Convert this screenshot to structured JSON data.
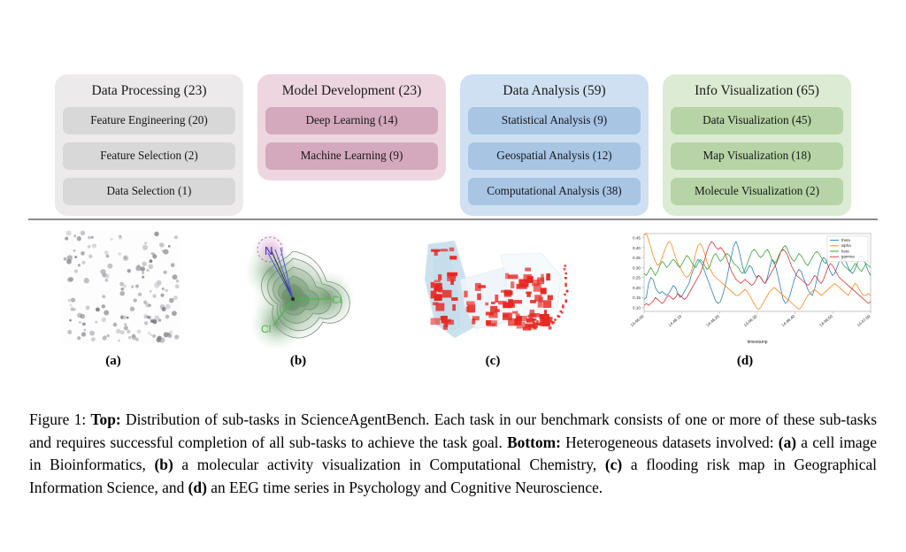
{
  "figure": {
    "label": "Figure 1:",
    "caption_segments": [
      {
        "text": "Figure 1: ",
        "bold": false
      },
      {
        "text": "Top:",
        "bold": true
      },
      {
        "text": " Distribution of sub-tasks in ScienceAgentBench. Each task in our benchmark consists of one or more of these sub-tasks and requires successful completion of all sub-tasks to achieve the task goal. ",
        "bold": false
      },
      {
        "text": "Bottom:",
        "bold": true
      },
      {
        "text": " Heterogeneous datasets involved: ",
        "bold": false
      },
      {
        "text": "(a)",
        "bold": true
      },
      {
        "text": " a cell image in Bioinformatics, ",
        "bold": false
      },
      {
        "text": "(b)",
        "bold": true
      },
      {
        "text": " a molecular activity visualization in Computational Chemistry, ",
        "bold": false
      },
      {
        "text": "(c)",
        "bold": true
      },
      {
        "text": " a flooding risk map in Geographical Information Science, and ",
        "bold": false
      },
      {
        "text": "(d)",
        "bold": true
      },
      {
        "text": " an EEG time series in Psychology and Cognitive Neuroscience.",
        "bold": false
      }
    ]
  },
  "taxonomy": {
    "categories": [
      {
        "title": "Data Processing (23)",
        "name": "data-processing",
        "palette": "pal-gray",
        "card_color": "#eceaea",
        "chip_color": "#d9d8d8",
        "subtasks": [
          {
            "label": "Feature Engineering (20)",
            "count": 20
          },
          {
            "label": "Feature Selection (2)",
            "count": 2
          },
          {
            "label": "Data Selection (1)",
            "count": 1
          }
        ]
      },
      {
        "title": "Model Development (23)",
        "name": "model-development",
        "palette": "pal-pink",
        "card_color": "#eed6e0",
        "chip_color": "#d4a9bd",
        "subtasks": [
          {
            "label": "Deep Learning (14)",
            "count": 14
          },
          {
            "label": "Machine Learning (9)",
            "count": 9
          }
        ]
      },
      {
        "title": "Data Analysis (59)",
        "name": "data-analysis",
        "palette": "pal-blue",
        "card_color": "#cfe0f2",
        "chip_color": "#a8c5e4",
        "subtasks": [
          {
            "label": "Statistical Analysis (9)",
            "count": 9
          },
          {
            "label": "Geospatial Analysis (12)",
            "count": 12
          },
          {
            "label": "Computational Analysis (38)",
            "count": 38
          }
        ]
      },
      {
        "title": "Info Visualization (65)",
        "name": "info-visualization",
        "palette": "pal-green",
        "card_color": "#dcebd3",
        "chip_color": "#b6d4a5",
        "subtasks": [
          {
            "label": "Data Visualization (45)",
            "count": 45
          },
          {
            "label": "Map Visualization (18)",
            "count": 18
          },
          {
            "label": "Molecule Visualization (2)",
            "count": 2
          }
        ]
      }
    ]
  },
  "panels": [
    {
      "key": "a",
      "caption": "(a)",
      "kind": "cell-image",
      "description": "cell image in Bioinformatics"
    },
    {
      "key": "b",
      "caption": "(b)",
      "kind": "molecule",
      "description": "molecular activity visualization in Computational Chemistry",
      "atom_labels": [
        {
          "text": "N",
          "color": "#3333cc"
        },
        {
          "text": "Cl",
          "color": "#44bb44"
        },
        {
          "text": "Cl",
          "color": "#44bb44"
        }
      ]
    },
    {
      "key": "c",
      "caption": "(c)",
      "kind": "map",
      "description": "flooding risk map in Geographical Information Science",
      "colors": {
        "water": "#c3dceb",
        "buildings": "#e8251f"
      }
    },
    {
      "key": "d",
      "caption": "(d)",
      "kind": "line-chart",
      "description": "EEG time series in Psychology and Cognitive Neuroscience"
    }
  ],
  "chart_data": {
    "type": "line",
    "title": "",
    "xlabel": "timestamp",
    "ylabel": "",
    "grid": false,
    "legend_position": "upper right",
    "ylim": [
      0.08,
      0.47
    ],
    "yticks": [
      0.1,
      0.15,
      0.2,
      0.25,
      0.3,
      0.35,
      0.4,
      0.45
    ],
    "ytick_labels": [
      "0.10",
      "0.15",
      "0.20",
      "0.25",
      "0.30",
      "0.35",
      "0.40",
      "0.45"
    ],
    "xticks": [
      0,
      10,
      20,
      30,
      40,
      50,
      60
    ],
    "xtick_labels": [
      "14:46:00",
      "14:46:10",
      "14:46:20",
      "14:46:30",
      "14:46:40",
      "14:46:50",
      "14:47:00"
    ],
    "series": [
      {
        "name": "theta",
        "color": "#1f77b4",
        "values": [
          0.14,
          0.15,
          0.22,
          0.25,
          0.24,
          0.2,
          0.18,
          0.17,
          0.18,
          0.17,
          0.16,
          0.17,
          0.19,
          0.21,
          0.2,
          0.17,
          0.15,
          0.16,
          0.18,
          0.2,
          0.22,
          0.26,
          0.29,
          0.32,
          0.34,
          0.33,
          0.31,
          0.28,
          0.25,
          0.22,
          0.19,
          0.16,
          0.13,
          0.12,
          0.13,
          0.16,
          0.2,
          0.25,
          0.31,
          0.36,
          0.41,
          0.43,
          0.4,
          0.35,
          0.3,
          0.27,
          0.29,
          0.31,
          0.3,
          0.27,
          0.25,
          0.26,
          0.25,
          0.23,
          0.22,
          0.25,
          0.3,
          0.34,
          0.33,
          0.29,
          0.24,
          0.19,
          0.14,
          0.12,
          0.13,
          0.16,
          0.2,
          0.24,
          0.27,
          0.29,
          0.28,
          0.25,
          0.22,
          0.19,
          0.17,
          0.16,
          0.19,
          0.24,
          0.29,
          0.33,
          0.35,
          0.34,
          0.31,
          0.28,
          0.26,
          0.27,
          0.3,
          0.33,
          0.36,
          0.35,
          0.33,
          0.3,
          0.28,
          0.27,
          0.29,
          0.32,
          0.35,
          0.36,
          0.34,
          0.31,
          0.28,
          0.26
        ]
      },
      {
        "name": "alpha",
        "color": "#ff7f0e",
        "values": [
          0.46,
          0.47,
          0.44,
          0.4,
          0.36,
          0.33,
          0.31,
          0.32,
          0.35,
          0.38,
          0.41,
          0.43,
          0.42,
          0.39,
          0.35,
          0.32,
          0.3,
          0.28,
          0.26,
          0.25,
          0.26,
          0.28,
          0.32,
          0.37,
          0.41,
          0.42,
          0.4,
          0.37,
          0.33,
          0.3,
          0.28,
          0.26,
          0.25,
          0.24,
          0.23,
          0.22,
          0.21,
          0.2,
          0.19,
          0.18,
          0.17,
          0.16,
          0.16,
          0.17,
          0.18,
          0.19,
          0.18,
          0.16,
          0.14,
          0.12,
          0.1,
          0.09,
          0.1,
          0.12,
          0.14,
          0.16,
          0.18,
          0.19,
          0.2,
          0.19,
          0.18,
          0.17,
          0.16,
          0.15,
          0.14,
          0.13,
          0.12,
          0.11,
          0.1,
          0.09,
          0.1,
          0.12,
          0.14,
          0.16,
          0.17,
          0.18,
          0.19,
          0.18,
          0.17,
          0.16,
          0.17,
          0.18,
          0.19,
          0.2,
          0.21,
          0.22,
          0.21,
          0.2,
          0.19,
          0.18,
          0.17,
          0.16,
          0.18,
          0.2,
          0.22,
          0.21,
          0.19,
          0.17,
          0.16,
          0.16,
          0.17,
          0.16
        ]
      },
      {
        "name": "beta",
        "color": "#2ca02c",
        "values": [
          0.27,
          0.26,
          0.28,
          0.3,
          0.28,
          0.26,
          0.28,
          0.31,
          0.33,
          0.32,
          0.3,
          0.31,
          0.33,
          0.34,
          0.33,
          0.31,
          0.3,
          0.32,
          0.34,
          0.36,
          0.35,
          0.33,
          0.31,
          0.3,
          0.32,
          0.34,
          0.33,
          0.31,
          0.29,
          0.3,
          0.33,
          0.36,
          0.37,
          0.35,
          0.33,
          0.34,
          0.36,
          0.37,
          0.36,
          0.34,
          0.32,
          0.31,
          0.3,
          0.28,
          0.27,
          0.29,
          0.32,
          0.35,
          0.38,
          0.39,
          0.38,
          0.36,
          0.35,
          0.36,
          0.38,
          0.39,
          0.37,
          0.34,
          0.32,
          0.33,
          0.36,
          0.38,
          0.4,
          0.41,
          0.39,
          0.36,
          0.34,
          0.33,
          0.35,
          0.37,
          0.36,
          0.34,
          0.32,
          0.31,
          0.33,
          0.35,
          0.37,
          0.38,
          0.37,
          0.35,
          0.33,
          0.32,
          0.34,
          0.36,
          0.38,
          0.39,
          0.37,
          0.35,
          0.33,
          0.31,
          0.3,
          0.29,
          0.28,
          0.3,
          0.32,
          0.31,
          0.29,
          0.28,
          0.3,
          0.32,
          0.31,
          0.3
        ]
      },
      {
        "name": "gamma",
        "color": "#d62728",
        "values": [
          0.11,
          0.12,
          0.11,
          0.12,
          0.13,
          0.15,
          0.14,
          0.13,
          0.12,
          0.13,
          0.15,
          0.16,
          0.15,
          0.14,
          0.15,
          0.17,
          0.16,
          0.15,
          0.14,
          0.15,
          0.17,
          0.19,
          0.21,
          0.23,
          0.25,
          0.27,
          0.3,
          0.34,
          0.38,
          0.41,
          0.43,
          0.42,
          0.4,
          0.39,
          0.4,
          0.39,
          0.37,
          0.34,
          0.31,
          0.28,
          0.26,
          0.24,
          0.23,
          0.22,
          0.23,
          0.24,
          0.23,
          0.22,
          0.21,
          0.22,
          0.24,
          0.26,
          0.25,
          0.23,
          0.22,
          0.24,
          0.26,
          0.28,
          0.3,
          0.32,
          0.35,
          0.38,
          0.39,
          0.38,
          0.36,
          0.33,
          0.3,
          0.28,
          0.26,
          0.25,
          0.24,
          0.23,
          0.22,
          0.21,
          0.22,
          0.24,
          0.26,
          0.25,
          0.23,
          0.22,
          0.24,
          0.27,
          0.3,
          0.32,
          0.31,
          0.29,
          0.27,
          0.25,
          0.24,
          0.23,
          0.22,
          0.21,
          0.2,
          0.19,
          0.18,
          0.17,
          0.16,
          0.15,
          0.14,
          0.13,
          0.12,
          0.13
        ]
      }
    ]
  }
}
